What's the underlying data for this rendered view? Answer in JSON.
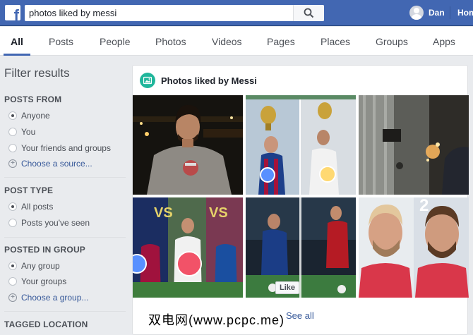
{
  "topbar": {
    "logo_letter": "f",
    "search_value": "photos liked by messi",
    "user_name": "Dan",
    "home_label": "Hom"
  },
  "tabs": [
    {
      "label": "All",
      "active": true
    },
    {
      "label": "Posts"
    },
    {
      "label": "People"
    },
    {
      "label": "Photos"
    },
    {
      "label": "Videos"
    },
    {
      "label": "Pages"
    },
    {
      "label": "Places"
    },
    {
      "label": "Groups"
    },
    {
      "label": "Apps"
    }
  ],
  "filter": {
    "title": "Filter results",
    "posts_from": {
      "heading": "POSTS FROM",
      "options": [
        "Anyone",
        "You",
        "Your friends and groups"
      ],
      "selected": "Anyone",
      "choose_link": "Choose a source..."
    },
    "post_type": {
      "heading": "POST TYPE",
      "options": [
        "All posts",
        "Posts you've seen"
      ],
      "selected": "All posts"
    },
    "posted_in_group": {
      "heading": "POSTED IN GROUP",
      "options": [
        "Any group",
        "Your groups"
      ],
      "selected": "Any group",
      "choose_link": "Choose a group..."
    },
    "tagged_location": {
      "heading": "TAGGED LOCATION"
    }
  },
  "results": {
    "title": "Photos liked by Messi",
    "see_all": "See all",
    "like_button": "Like",
    "photo_number": "2"
  },
  "watermark": "双电网(www.pcpc.me)",
  "colors": {
    "brand_blue": "#4267b2",
    "link": "#365899",
    "photos_icon_green": "#20b69b",
    "love_red": "#f25268",
    "like_blue": "#5890ff"
  }
}
